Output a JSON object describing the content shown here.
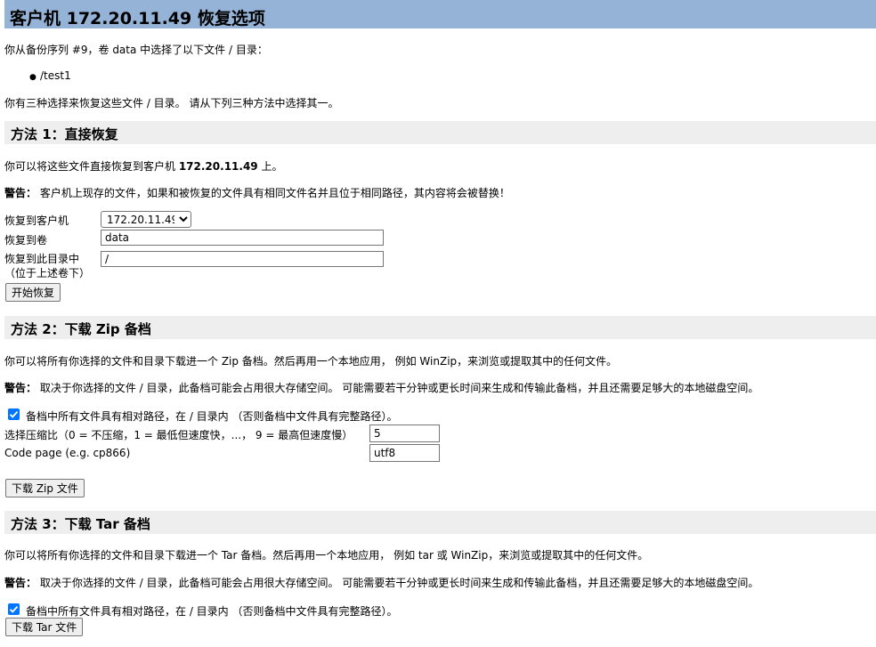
{
  "header": {
    "title": "客户机 172.20.11.49 恢复选项"
  },
  "intro": {
    "selection_text": "你从备份序列 #9，卷 data 中选择了以下文件 / 目录：",
    "files": [
      "/test1"
    ],
    "choice_text": "你有三种选择来恢复这些文件 / 目录。 请从下列三种方法中选择其一。"
  },
  "method1": {
    "heading": "方法 1：直接恢复",
    "desc_prefix": "你可以将这些文件直接恢复到客户机 ",
    "desc_host": "172.20.11.49",
    "desc_suffix": " 上。",
    "warning_label": "警告：",
    "warning_text": " 客户机上现存的文件，如果和被恢复的文件具有相同文件名并且位于相同路径，其内容将会被替换！",
    "host_label": "恢复到客户机",
    "host_value": "172.20.11.49",
    "share_label": "恢复到卷",
    "share_value": "data",
    "dir_label_1": "恢复到此目录中",
    "dir_label_2": "（位于上述卷下）",
    "dir_value": "/",
    "start_button": "开始恢复"
  },
  "method2": {
    "heading": "方法 2：下载 Zip 备档",
    "desc": "你可以将所有你选择的文件和目录下载进一个 Zip 备档。然后再用一个本地应用， 例如 WinZip，来浏览或提取其中的任何文件。",
    "warning_label": "警告：",
    "warning_text": " 取决于你选择的文件 / 目录，此备档可能会占用很大存储空间。 可能需要若干分钟或更长时间来生成和传输此备档，并且还需要足够大的本地磁盘空间。",
    "relative_checkbox": "备档中所有文件具有相对路径，在 / 目录内 （否则备档中文件具有完整路径）。",
    "relative_checked": true,
    "compress_label": "选择压缩比（0 = 不压缩，1 = 最低但速度快，...， 9 = 最高但速度慢）",
    "compress_value": "5",
    "codepage_label": "Code page (e.g. cp866)",
    "codepage_value": "utf8",
    "download_button": "下载 Zip 文件"
  },
  "method3": {
    "heading": "方法 3：下载 Tar 备档",
    "desc": "你可以将所有你选择的文件和目录下载进一个 Tar 备档。然后再用一个本地应用， 例如 tar 或 WinZip，来浏览或提取其中的任何文件。",
    "warning_label": "警告：",
    "warning_text": " 取决于你选择的文件 / 目录，此备档可能会占用很大存储空间。 可能需要若干分钟或更长时间来生成和传输此备档，并且还需要足够大的本地磁盘空间。",
    "relative_checkbox": "备档中所有文件具有相对路径，在 / 目录内 （否则备档中文件具有完整路径）。",
    "relative_checked": true,
    "download_button": "下载 Tar 文件"
  },
  "colors": {
    "title_bar": "#95b3d7",
    "section_bar": "#eeeeee",
    "checkbox": "#0075ff"
  }
}
